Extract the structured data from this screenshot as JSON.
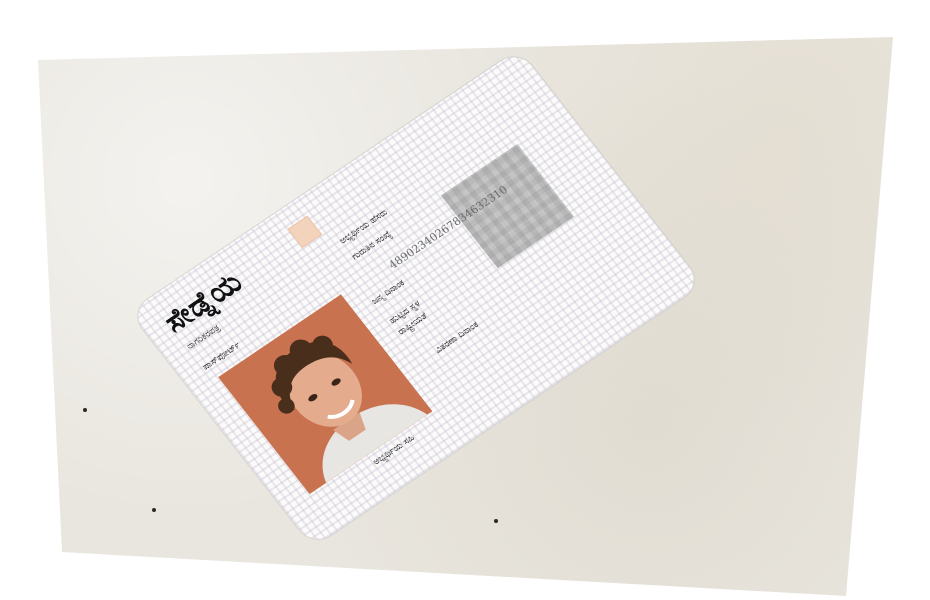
{
  "card": {
    "title": "ಸೇಡ್ನೆಯ",
    "subtitle": "ನಾಗರಿಕರಪತ್ರ",
    "photo_label": "ಪಾಸ್‌ಪೋರ್ಟ್",
    "signature_label": "ಅಭ್ಯರ್ಥಿಯ ಸಹಿ",
    "id_number": "48902340267834632310",
    "fields": [
      {
        "label": "ಅಭ್ಯರ್ಥಿಯ ಹೆಸರು"
      },
      {
        "label": "ಗುರುತಿನ ಸಂಖ್ಯೆ"
      },
      {
        "label": "ಜನ್ಮ ದಿನಾಂಕ"
      },
      {
        "label": "ಹುಟ್ಟಿದ ಸ್ಥಳ"
      },
      {
        "label": "ರಾಷ್ಟ್ರೀಯತೆ"
      },
      {
        "label": "ವಿತರಣಾ ದಿನಾಂಕ"
      }
    ]
  },
  "colors": {
    "photo_background": "#c8724f",
    "emblem": "#f4d3bd",
    "paper": "#e9e6df"
  }
}
